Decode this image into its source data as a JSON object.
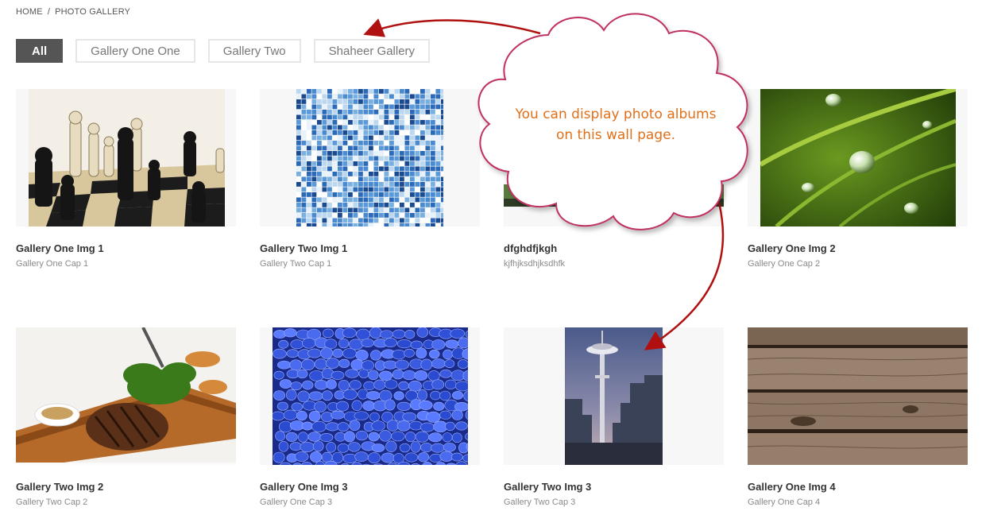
{
  "breadcrumb": {
    "home": "HOME",
    "separator": "/",
    "current": "PHOTO GALLERY"
  },
  "filters": [
    {
      "label": "All",
      "active": true
    },
    {
      "label": "Gallery One One",
      "active": false
    },
    {
      "label": "Gallery Two",
      "active": false
    },
    {
      "label": "Shaheer Gallery",
      "active": false
    }
  ],
  "items": [
    {
      "title": "Gallery One Img 1",
      "caption": "Gallery One Cap 1",
      "image": "chess-image"
    },
    {
      "title": "Gallery Two Img 1",
      "caption": "Gallery Two Cap 1",
      "image": "blue-mosaic-image"
    },
    {
      "title": "dfghdfjkgh",
      "caption": "kjfhjksdhjksdhfk",
      "image": "landscape-image"
    },
    {
      "title": "Gallery One Img 2",
      "caption": "Gallery One Cap 2",
      "image": "dewdrops-grass-image"
    },
    {
      "title": "Gallery Two Img 2",
      "caption": "Gallery Two Cap 2",
      "image": "steak-dish-image"
    },
    {
      "title": "Gallery One Img 3",
      "caption": "Gallery One Cap 3",
      "image": "blue-pebbles-image"
    },
    {
      "title": "Gallery Two Img 3",
      "caption": "Gallery Two Cap 3",
      "image": "space-needle-image"
    },
    {
      "title": "Gallery One Img 4",
      "caption": "Gallery One Cap 4",
      "image": "wood-planks-image"
    }
  ],
  "callout": {
    "line1": "You can display photo albums",
    "line2": "on this wall page."
  },
  "colors": {
    "active_filter": "#555555",
    "callout_text": "#e0701a",
    "arrow": "#b01010",
    "cloud_border": "#c03060"
  }
}
